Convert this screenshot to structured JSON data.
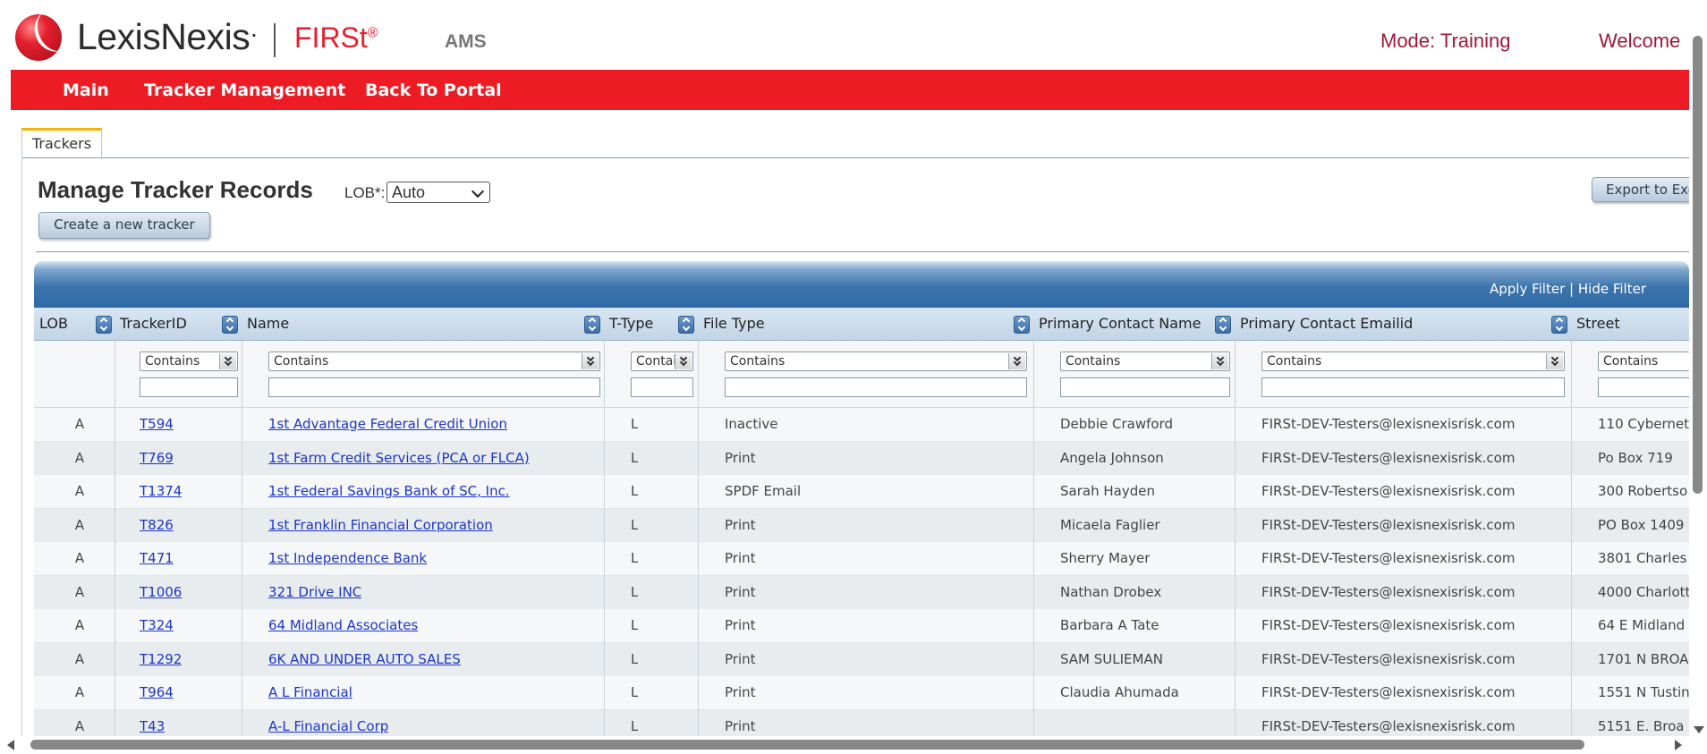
{
  "header": {
    "logo_text": "LexisNexis",
    "logo_mark": "·",
    "product": "FIRSt",
    "product_mark": "®",
    "module": "AMS",
    "mode": "Mode: Training",
    "welcome": "Welcome"
  },
  "nav": {
    "items": [
      "Main",
      "Tracker Management",
      "Back To Portal"
    ]
  },
  "tabs": [
    "Trackers"
  ],
  "page": {
    "title": "Manage Tracker Records",
    "lob_label": "LOB*:",
    "lob_value": "Auto",
    "create_button": "Create a new tracker",
    "export_button": "Export to Excel"
  },
  "grid": {
    "apply_filter": "Apply Filter",
    "separator": "|",
    "hide_filter": "Hide Filter",
    "columns": [
      "LOB",
      "TrackerID",
      "Name",
      "T-Type",
      "File Type",
      "Primary Contact Name",
      "Primary Contact Emailid",
      "Street"
    ],
    "filter_option": "Contains",
    "rows": [
      [
        "A",
        "T594",
        "1st Advantage Federal Credit Union",
        "L",
        "Inactive",
        "Debbie Crawford",
        "FIRSt-DEV-Testers@lexisnexisrisk.com",
        "110 Cybernet"
      ],
      [
        "A",
        "T769",
        "1st Farm Credit Services (PCA or FLCA)",
        "L",
        "Print",
        "Angela Johnson",
        "FIRSt-DEV-Testers@lexisnexisrisk.com",
        "Po Box 719"
      ],
      [
        "A",
        "T1374",
        "1st Federal Savings Bank of SC, Inc.",
        "L",
        "SPDF Email",
        "Sarah Hayden",
        "FIRSt-DEV-Testers@lexisnexisrisk.com",
        "300 Robertso"
      ],
      [
        "A",
        "T826",
        "1st Franklin Financial Corporation",
        "L",
        "Print",
        "Micaela Faglier",
        "FIRSt-DEV-Testers@lexisnexisrisk.com",
        "PO Box 1409"
      ],
      [
        "A",
        "T471",
        "1st Independence Bank",
        "L",
        "Print",
        "Sherry Mayer",
        "FIRSt-DEV-Testers@lexisnexisrisk.com",
        "3801 Charles"
      ],
      [
        "A",
        "T1006",
        "321 Drive INC",
        "L",
        "Print",
        "Nathan Drobex",
        "FIRSt-DEV-Testers@lexisnexisrisk.com",
        "4000 Charlott"
      ],
      [
        "A",
        "T324",
        "64 Midland Associates",
        "L",
        "Print",
        "Barbara A Tate",
        "FIRSt-DEV-Testers@lexisnexisrisk.com",
        "64 E Midland"
      ],
      [
        "A",
        "T1292",
        "6K AND UNDER AUTO SALES",
        "L",
        "Print",
        "SAM SULIEMAN",
        "FIRSt-DEV-Testers@lexisnexisrisk.com",
        "1701 N BROA"
      ],
      [
        "A",
        "T964",
        "A L Financial",
        "L",
        "Print",
        "Claudia Ahumada",
        "FIRSt-DEV-Testers@lexisnexisrisk.com",
        "1551 N Tustin"
      ],
      [
        "A",
        "T43",
        "A-L Financial Corp",
        "L",
        "Print",
        "",
        "FIRSt-DEV-Testers@lexisnexisrisk.com",
        "5151 E. Broa"
      ]
    ]
  }
}
